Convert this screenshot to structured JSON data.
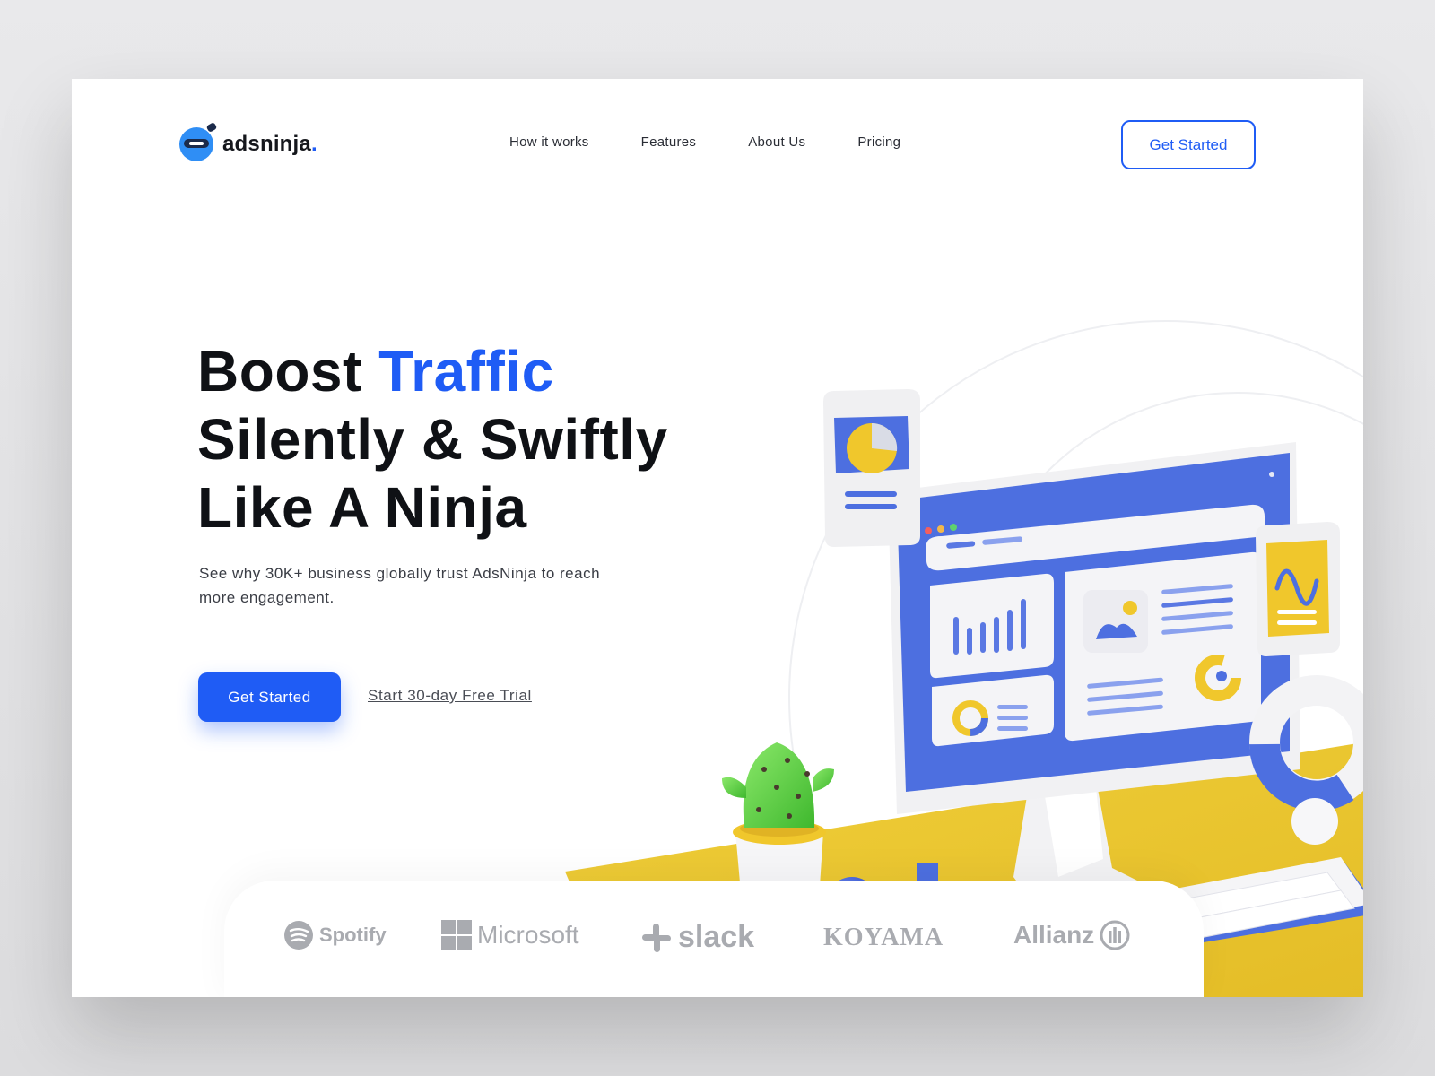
{
  "brand": {
    "name": "adsninja",
    "dot": ".",
    "color": "#1f5cf5"
  },
  "nav": {
    "items": [
      {
        "label": "How it works"
      },
      {
        "label": "Features"
      },
      {
        "label": "About Us"
      },
      {
        "label": "Pricing"
      }
    ],
    "cta_label": "Get Started"
  },
  "hero": {
    "title_line1_a": "Boost ",
    "title_line1_b": "Traffic",
    "title_line2": "Silently & Swiftly",
    "title_line3": "Like A Ninja",
    "subtitle": "See why 30K+ business globally trust AdsNinja to reach more engagement.",
    "cta_label": "Get Started",
    "trial_label": "Start 30-day Free Trial"
  },
  "brands": [
    {
      "name": "Spotify",
      "icon": "spotify-icon"
    },
    {
      "name": "Microsoft",
      "icon": "windows-icon"
    },
    {
      "name": "slack",
      "icon": "slack-icon"
    },
    {
      "name": "KOYAMA",
      "icon": ""
    },
    {
      "name": "Allianz",
      "icon": "allianz-icon"
    }
  ],
  "colors": {
    "accent": "#1f5cf5",
    "yellow": "#e9c531",
    "monitor_blue": "#4d6fe0",
    "brand_gray": "#a9abb0"
  }
}
